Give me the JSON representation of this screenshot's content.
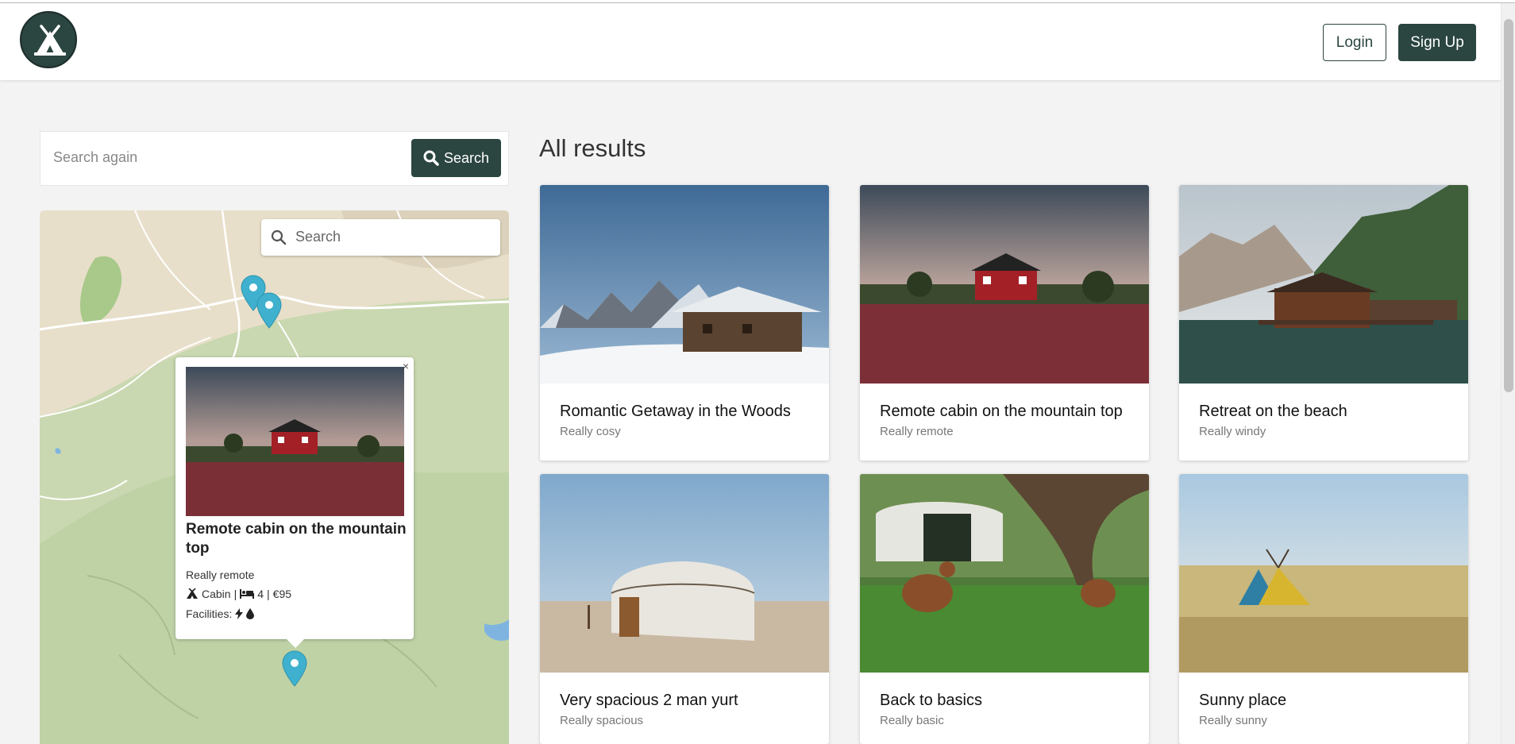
{
  "header": {
    "logo_icon": "tent-icon",
    "login_label": "Login",
    "signup_label": "Sign Up"
  },
  "search": {
    "placeholder": "Search again",
    "button_label": "Search"
  },
  "map": {
    "search_placeholder": "Search",
    "popup": {
      "close": "×",
      "title": "Remote cabin on the mountain top",
      "subtitle": "Really remote",
      "type": "Cabin",
      "beds": "4",
      "price": "€95",
      "facilities_label": "Facilities:"
    }
  },
  "results": {
    "title": "All results",
    "cards": [
      {
        "title": "Romantic Getaway in the Woods",
        "subtitle": "Really cosy"
      },
      {
        "title": "Remote cabin on the mountain top",
        "subtitle": "Really remote"
      },
      {
        "title": "Retreat on the beach",
        "subtitle": "Really windy"
      },
      {
        "title": "Very spacious 2 man yurt",
        "subtitle": "Really spacious"
      },
      {
        "title": "Back to basics",
        "subtitle": "Really basic"
      },
      {
        "title": "Sunny place",
        "subtitle": "Really sunny"
      }
    ]
  },
  "colors": {
    "brand": "#2b4540",
    "background": "#f3f3f3",
    "pin": "#3fb1ce"
  }
}
